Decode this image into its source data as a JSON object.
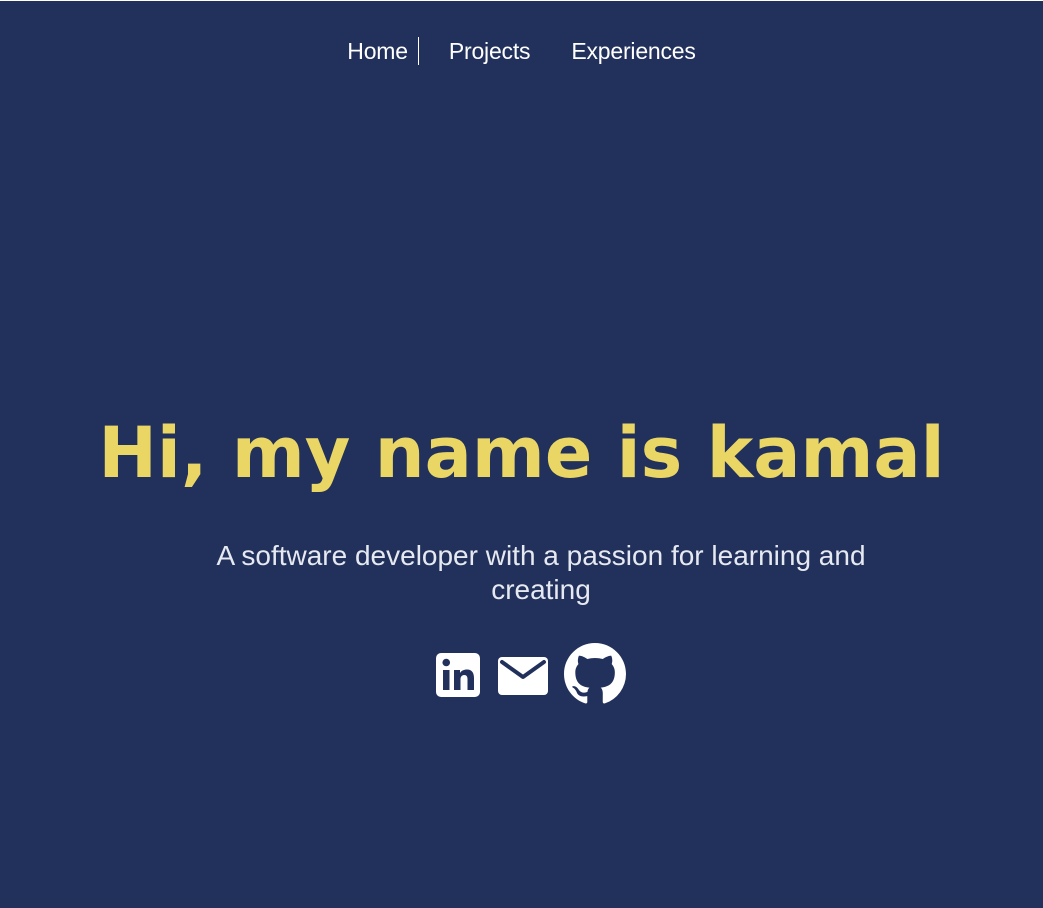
{
  "nav": {
    "items": [
      {
        "label": "Home"
      },
      {
        "label": "Projects"
      },
      {
        "label": "Experiences"
      }
    ]
  },
  "hero": {
    "title": "Hi, my name is kamal",
    "tagline": "A software developer with a passion for learning and creating"
  },
  "socials": [
    {
      "icon": "linkedin-icon"
    },
    {
      "icon": "mail-icon"
    },
    {
      "icon": "github-icon"
    }
  ],
  "colors": {
    "background": "#22315c",
    "accent": "#ead664",
    "text": "#ffffff"
  }
}
